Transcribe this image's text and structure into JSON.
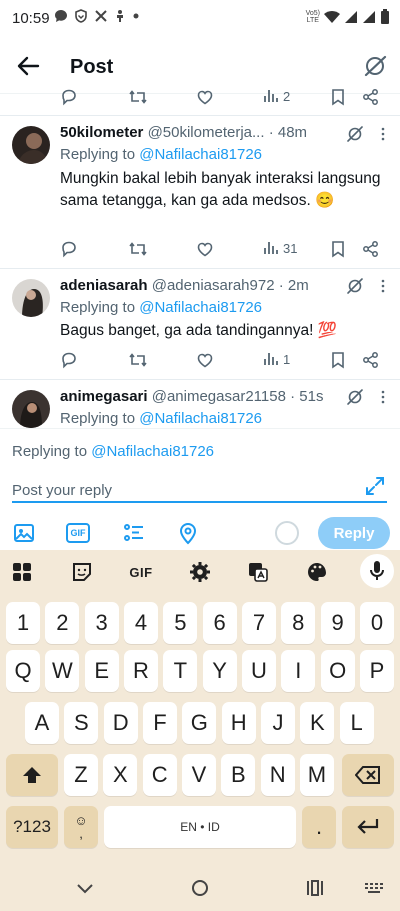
{
  "status_bar": {
    "time": "10:59",
    "network_label_top": "Vo5)",
    "network_label_bottom": "LTE"
  },
  "header": {
    "title": "Post"
  },
  "prev_tweet_actions": {
    "views": "2"
  },
  "tweets": [
    {
      "name": "50kilometer",
      "handle": "@50kilometerja...",
      "time": "· 48m",
      "replying_label": "Replying to ",
      "replying_to": "@Nafilachai81726",
      "text": "Mungkin bakal lebih banyak interaksi langsung sama tetangga, kan ga ada medsos. 😊",
      "views": "31"
    },
    {
      "name": "adeniasarah",
      "handle": "@adeniasarah972",
      "time": "· 2m",
      "replying_label": "Replying to ",
      "replying_to": "@Nafilachai81726",
      "text": "Bagus banget, ga ada tandingannya! 💯",
      "views": "1"
    },
    {
      "name": "animegasari",
      "handle": "@animegasar21158",
      "time": "· 51s",
      "replying_label": "Replying to ",
      "replying_to": "@Nafilachai81726"
    }
  ],
  "composer": {
    "replying_label": "Replying to ",
    "replying_to": "@Nafilachai81726",
    "placeholder": "Post your reply",
    "reply_button": "Reply",
    "gif_label": "GIF"
  },
  "keyboard": {
    "toolbar_gif": "GIF",
    "row_numbers": [
      "1",
      "2",
      "3",
      "4",
      "5",
      "6",
      "7",
      "8",
      "9",
      "0"
    ],
    "row_q": [
      "Q",
      "W",
      "E",
      "R",
      "T",
      "Y",
      "U",
      "I",
      "O",
      "P"
    ],
    "row_a": [
      "A",
      "S",
      "D",
      "F",
      "G",
      "H",
      "J",
      "K",
      "L"
    ],
    "row_z": [
      "Z",
      "X",
      "C",
      "V",
      "B",
      "N",
      "M"
    ],
    "symbols_key": "?123",
    "emoji_key_top": "☺",
    "emoji_key_bottom": ",",
    "space_label": "EN • ID",
    "period_key": "."
  },
  "colors": {
    "accent": "#1d9bf0",
    "reply_button": "#8ecdf8",
    "keyboard_bg": "#f3e9d8",
    "keyboard_dark_key": "#e9d6b0"
  }
}
